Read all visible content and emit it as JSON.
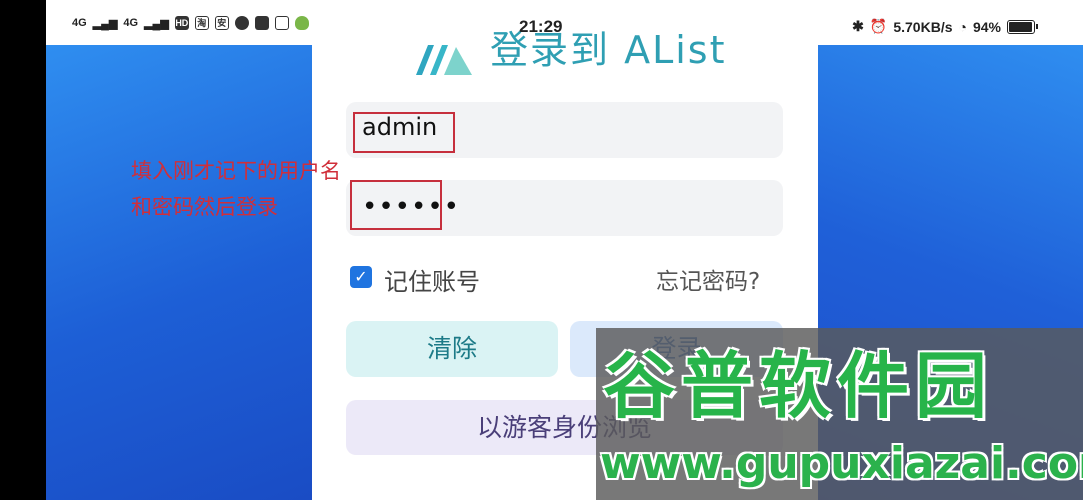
{
  "status_bar": {
    "signal_1": "4G",
    "signal_2": "4G",
    "hd_badge": "HD",
    "app_icon_1": "淘",
    "app_icon_2": "安",
    "time": "21:29",
    "network_speed": "5.70KB/s",
    "battery": "94%"
  },
  "page": {
    "title": "登录到 AList"
  },
  "form": {
    "username_value": "admin",
    "password_value": "••••••",
    "remember_checked": true,
    "remember_label": "记住账号",
    "forgot_label": "忘记密码?",
    "clear_button": "清除",
    "login_button": "登录",
    "guest_button": "以游客身份浏览"
  },
  "annotation": {
    "line1": "填入刚才记下的用户名",
    "line2": "和密码然后登录"
  },
  "watermark": {
    "name": "谷普软件园",
    "url": "www.gupuxiazai.com"
  },
  "colors": {
    "background_blue": "#1f62d8",
    "annotation_red": "#d02f3a",
    "checkbox_blue": "#1f74e0",
    "watermark_green": "#27b44a"
  }
}
